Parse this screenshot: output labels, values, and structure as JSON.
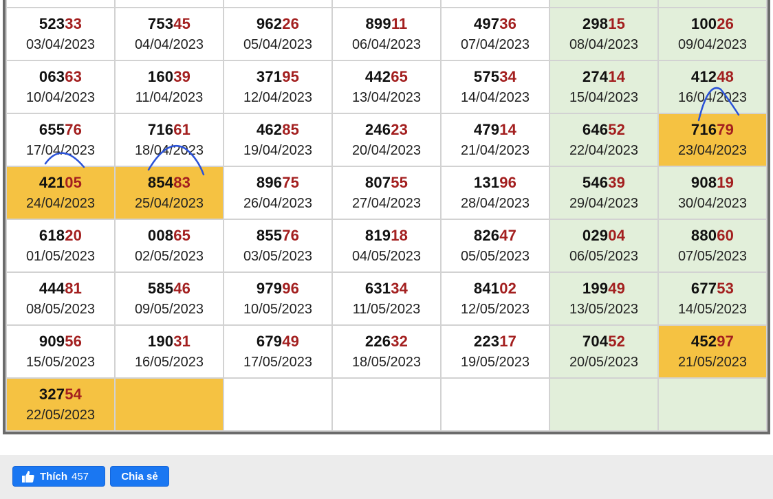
{
  "rows": [
    [
      {
        "head": "523",
        "tail": "33",
        "date": "03/04/2023"
      },
      {
        "head": "753",
        "tail": "45",
        "date": "04/04/2023"
      },
      {
        "head": "962",
        "tail": "26",
        "date": "05/04/2023"
      },
      {
        "head": "899",
        "tail": "11",
        "date": "06/04/2023"
      },
      {
        "head": "497",
        "tail": "36",
        "date": "07/04/2023"
      },
      {
        "head": "298",
        "tail": "15",
        "date": "08/04/2023"
      },
      {
        "head": "100",
        "tail": "26",
        "date": "09/04/2023"
      }
    ],
    [
      {
        "head": "063",
        "tail": "63",
        "date": "10/04/2023"
      },
      {
        "head": "160",
        "tail": "39",
        "date": "11/04/2023"
      },
      {
        "head": "371",
        "tail": "95",
        "date": "12/04/2023"
      },
      {
        "head": "442",
        "tail": "65",
        "date": "13/04/2023"
      },
      {
        "head": "575",
        "tail": "34",
        "date": "14/04/2023"
      },
      {
        "head": "274",
        "tail": "14",
        "date": "15/04/2023"
      },
      {
        "head": "412",
        "tail": "48",
        "date": "16/04/2023"
      }
    ],
    [
      {
        "head": "655",
        "tail": "76",
        "date": "17/04/2023"
      },
      {
        "head": "716",
        "tail": "61",
        "date": "18/04/2023"
      },
      {
        "head": "462",
        "tail": "85",
        "date": "19/04/2023"
      },
      {
        "head": "246",
        "tail": "23",
        "date": "20/04/2023"
      },
      {
        "head": "479",
        "tail": "14",
        "date": "21/04/2023"
      },
      {
        "head": "646",
        "tail": "52",
        "date": "22/04/2023"
      },
      {
        "head": "716",
        "tail": "79",
        "date": "23/04/2023"
      }
    ],
    [
      {
        "head": "421",
        "tail": "05",
        "date": "24/04/2023"
      },
      {
        "head": "854",
        "tail": "83",
        "date": "25/04/2023"
      },
      {
        "head": "896",
        "tail": "75",
        "date": "26/04/2023"
      },
      {
        "head": "807",
        "tail": "55",
        "date": "27/04/2023"
      },
      {
        "head": "131",
        "tail": "96",
        "date": "28/04/2023"
      },
      {
        "head": "546",
        "tail": "39",
        "date": "29/04/2023"
      },
      {
        "head": "908",
        "tail": "19",
        "date": "30/04/2023"
      }
    ],
    [
      {
        "head": "618",
        "tail": "20",
        "date": "01/05/2023"
      },
      {
        "head": "008",
        "tail": "65",
        "date": "02/05/2023"
      },
      {
        "head": "855",
        "tail": "76",
        "date": "03/05/2023"
      },
      {
        "head": "819",
        "tail": "18",
        "date": "04/05/2023"
      },
      {
        "head": "826",
        "tail": "47",
        "date": "05/05/2023"
      },
      {
        "head": "029",
        "tail": "04",
        "date": "06/05/2023"
      },
      {
        "head": "880",
        "tail": "60",
        "date": "07/05/2023"
      }
    ],
    [
      {
        "head": "444",
        "tail": "81",
        "date": "08/05/2023"
      },
      {
        "head": "585",
        "tail": "46",
        "date": "09/05/2023"
      },
      {
        "head": "979",
        "tail": "96",
        "date": "10/05/2023"
      },
      {
        "head": "631",
        "tail": "34",
        "date": "11/05/2023"
      },
      {
        "head": "841",
        "tail": "02",
        "date": "12/05/2023"
      },
      {
        "head": "199",
        "tail": "49",
        "date": "13/05/2023"
      },
      {
        "head": "677",
        "tail": "53",
        "date": "14/05/2023"
      }
    ],
    [
      {
        "head": "909",
        "tail": "56",
        "date": "15/05/2023"
      },
      {
        "head": "190",
        "tail": "31",
        "date": "16/05/2023"
      },
      {
        "head": "679",
        "tail": "49",
        "date": "17/05/2023"
      },
      {
        "head": "226",
        "tail": "32",
        "date": "18/05/2023"
      },
      {
        "head": "223",
        "tail": "17",
        "date": "19/05/2023"
      },
      {
        "head": "704",
        "tail": "52",
        "date": "20/05/2023"
      },
      {
        "head": "452",
        "tail": "97",
        "date": "21/05/2023"
      }
    ],
    [
      {
        "head": "327",
        "tail": "54",
        "date": "22/05/2023"
      }
    ]
  ],
  "colors": {
    "weekend_bg": "#e2efda",
    "highlight_bg": "#f5c242",
    "tail_digits": "#a31f1f",
    "ink_marks": "#2a52d8",
    "fb_blue": "#1a77f2"
  },
  "social": {
    "like_label": "Thích",
    "like_count": "457",
    "share_label": "Chia sẻ",
    "like_icon": "thumbs-up-icon"
  }
}
